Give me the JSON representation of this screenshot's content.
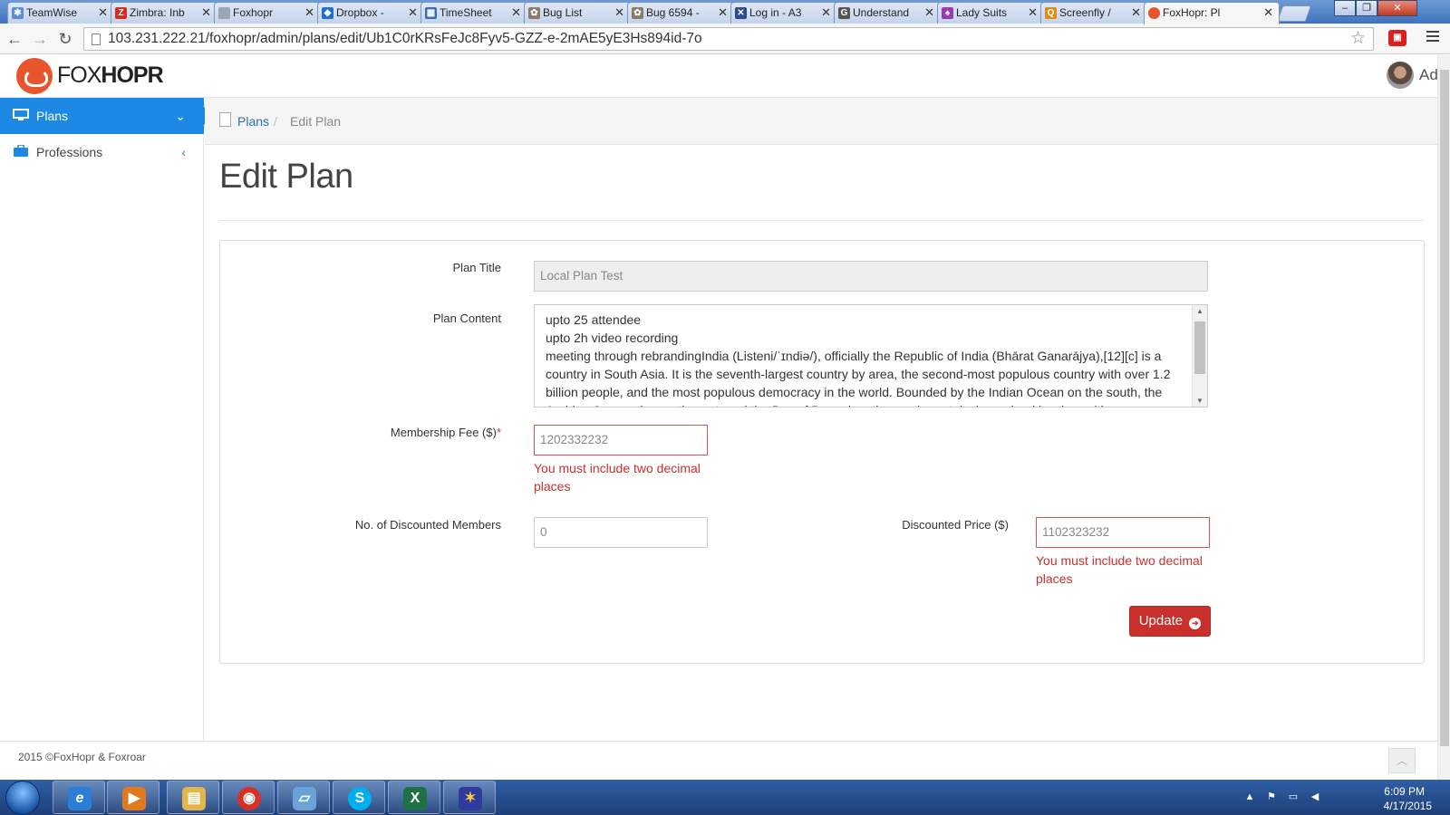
{
  "browser": {
    "tabs": [
      {
        "label": "TeamWise",
        "icon": "teamwise-icon",
        "color": "#5b8ed6"
      },
      {
        "label": "Zimbra: Inb",
        "icon": "zimbra-icon",
        "color": "#d62d20"
      },
      {
        "label": "Foxhopr",
        "icon": "page-icon",
        "color": "#9aa6b2"
      },
      {
        "label": "Dropbox - ",
        "icon": "dropbox-icon",
        "color": "#1f6fd1"
      },
      {
        "label": "TimeSheet ",
        "icon": "timesheet-icon",
        "color": "#3a6ab4"
      },
      {
        "label": "Bug List",
        "icon": "bug-icon",
        "color": "#8c7b6a"
      },
      {
        "label": "Bug 6594 - ",
        "icon": "bug-icon",
        "color": "#8c7b6a"
      },
      {
        "label": "Log in - A3",
        "icon": "login-icon",
        "color": "#2a4d8c"
      },
      {
        "label": "Understand",
        "icon": "understand-icon",
        "color": "#555555"
      },
      {
        "label": "Lady Suits",
        "icon": "ladysuits-icon",
        "color": "#9a3bb0"
      },
      {
        "label": "Screenfly / ",
        "icon": "screenfly-icon",
        "color": "#e08a1a"
      },
      {
        "label": "FoxHopr: Pl",
        "icon": "foxhopr-icon",
        "color": "#e8542c"
      }
    ],
    "active_tab_index": 11,
    "url": "103.231.222.21/foxhopr/admin/plans/edit/Ub1C0rKRsFeJc8Fyv5-GZZ-e-2mAE5yE3Hs894id-7o",
    "back": "←",
    "forward": "→",
    "reload": "↻",
    "star": "☆"
  },
  "app": {
    "logo_light": "FOX",
    "logo_bold": "HOPR",
    "user_name": "Admin",
    "accent": "#1e88e5"
  },
  "sidebar": {
    "items": [
      {
        "label": "Plans",
        "chevron": "⌄"
      },
      {
        "label": "Professions",
        "chevron": "‹"
      }
    ]
  },
  "breadcrumb": {
    "plans": "Plans",
    "separator": "/",
    "current": "Edit Plan"
  },
  "page": {
    "title": "Edit Plan"
  },
  "form": {
    "plan_title_label": "Plan Title",
    "plan_title_value": "Local Plan Test",
    "plan_content_label": "Plan Content",
    "plan_content_value": "upto 25 attendee\nupto 2h video recording\nmeeting through rebrandingIndia (Listeni/ˈɪndiə/), officially the Republic of India (Bhārat Ganarājya),[12][c] is a country in South Asia. It is the seventh-largest country by area, the second-most populous country with over 1.2 billion people, and the most populous democracy in the world. Bounded by the Indian Ocean on the south, the Arabian Sea on the south-west, and the Bay of Bengal on the south-east, it shares land borders with",
    "membership_fee_label": "Membership Fee ($)",
    "membership_fee_required": "*",
    "membership_fee_value": "1202332232",
    "membership_fee_error": "You must include two decimal places",
    "discounted_members_label": "No. of Discounted Members",
    "discounted_members_value": "0",
    "discounted_price_label": "Discounted Price ($)",
    "discounted_price_value": "1102323232",
    "discounted_price_error": "You must include two decimal places",
    "update_label": "Update",
    "error_color": "#c9302c"
  },
  "footer": {
    "text": "2015 ©FoxHopr & Foxroar",
    "scroll_top": "︿"
  },
  "taskbar": {
    "apps": [
      {
        "name": "internet-explorer-icon",
        "glyph": "e",
        "color": "#2a7fd4"
      },
      {
        "name": "media-player-icon",
        "glyph": "▶",
        "color": "#e07a1f"
      },
      {
        "name": "file-explorer-icon",
        "glyph": "▤",
        "color": "#e2b64a"
      },
      {
        "name": "chrome-icon",
        "glyph": "◉",
        "color": "#d93025"
      },
      {
        "name": "notepad-icon",
        "glyph": "▱",
        "color": "#6aa3d8"
      },
      {
        "name": "skype-icon",
        "glyph": "S",
        "color": "#00aff0"
      },
      {
        "name": "excel-icon",
        "glyph": "X",
        "color": "#1e7145"
      },
      {
        "name": "paint-app-icon",
        "glyph": "✶",
        "color": "#2f3a9c"
      }
    ],
    "time": "6:09 PM",
    "date": "4/17/2015"
  }
}
